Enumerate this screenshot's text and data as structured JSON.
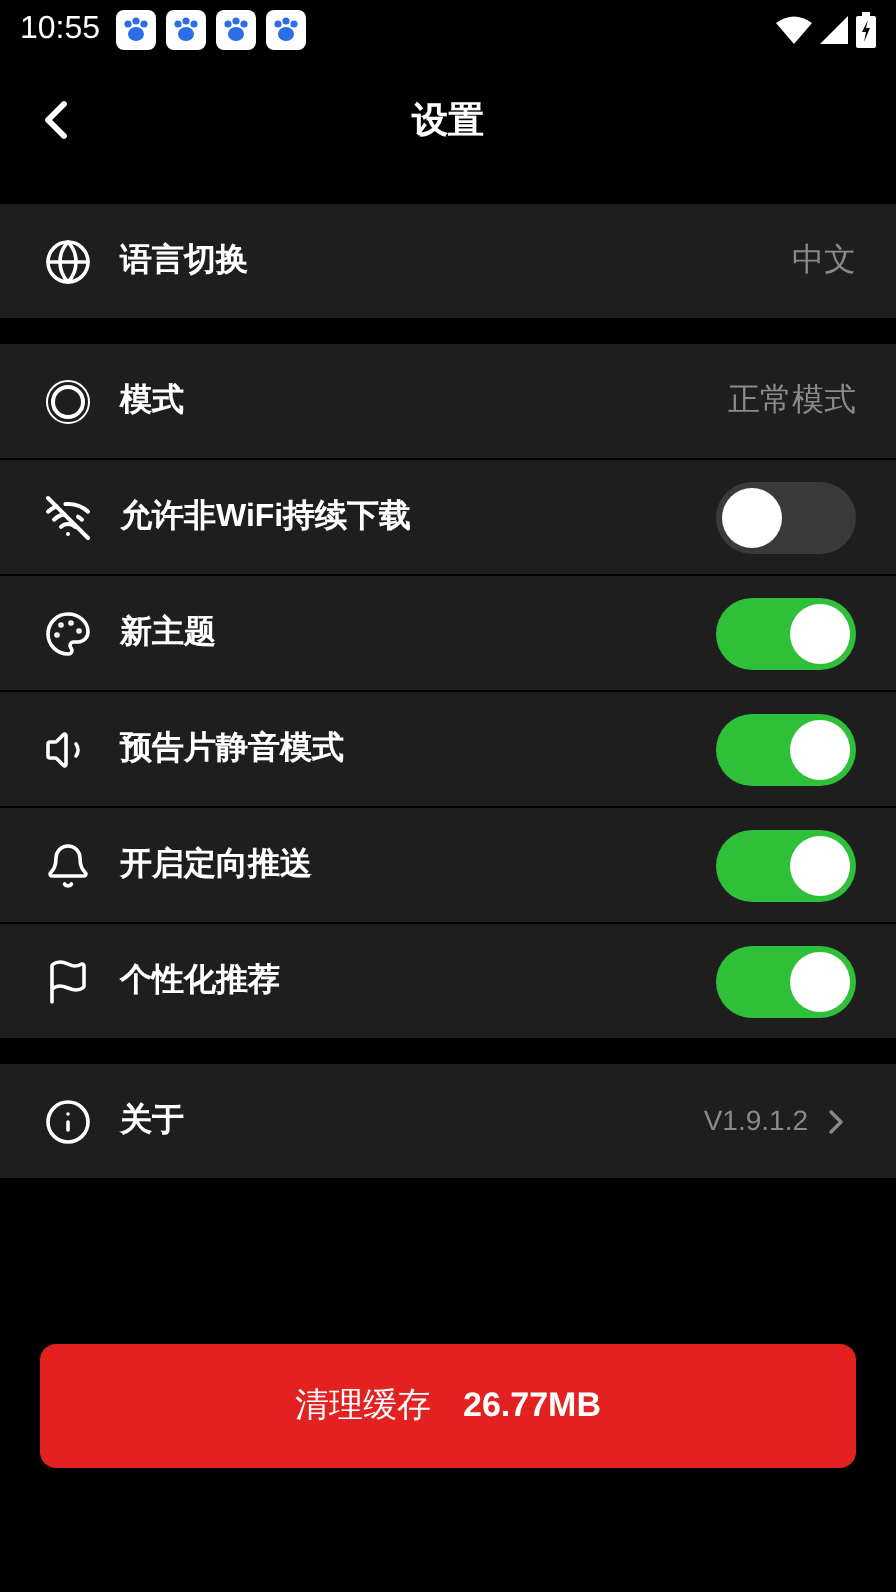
{
  "status_bar": {
    "time": "10:55"
  },
  "header": {
    "title": "设置"
  },
  "groups": [
    {
      "rows": [
        {
          "kind": "value",
          "label": "语言切换",
          "value": "中文"
        }
      ]
    },
    {
      "rows": [
        {
          "kind": "value",
          "label": "模式",
          "value": "正常模式"
        },
        {
          "kind": "toggle",
          "label": "允许非WiFi持续下载",
          "on": false
        },
        {
          "kind": "toggle",
          "label": "新主题",
          "on": true
        },
        {
          "kind": "toggle",
          "label": "预告片静音模式",
          "on": true
        },
        {
          "kind": "toggle",
          "label": "开启定向推送",
          "on": true
        },
        {
          "kind": "toggle",
          "label": "个性化推荐",
          "on": true
        }
      ]
    },
    {
      "rows": [
        {
          "kind": "link",
          "label": "关于",
          "value": "V1.9.1.2"
        }
      ]
    }
  ],
  "clear_button": {
    "label": "清理缓存",
    "size": "26.77MB"
  }
}
